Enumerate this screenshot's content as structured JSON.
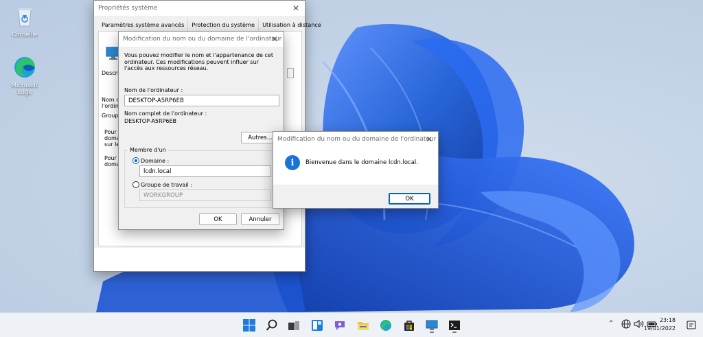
{
  "desktop": {
    "icons": [
      {
        "label": "Corbeille",
        "icon": "recycle-bin-icon"
      },
      {
        "label": "Microsoft Edge",
        "icon": "edge-icon"
      }
    ]
  },
  "system_properties": {
    "title": "Propriétés système",
    "tabs": [
      "Paramètres système avancés",
      "Protection du système",
      "Utilisation à distance"
    ],
    "fragments": {
      "descr": "Descrip",
      "nom1": "Nom co",
      "nom2": "l'ordina",
      "groupe": "Groupe",
      "pour1a": "Pour u",
      "pour1b": "domair",
      "pour1c": "sur le n",
      "pour2a": "Pour re",
      "pour2b": "domain"
    }
  },
  "rename_dialog": {
    "title": "Modification du nom ou du domaine de l'ordinateur",
    "intro": "Vous pouvez modifier le nom et l'appartenance de cet ordinateur. Ces modifications peuvent influer sur l'accès aux ressources réseau.",
    "computer_name_label": "Nom de l'ordinateur :",
    "computer_name_value": "DESKTOP-A5RP6EB",
    "full_name_label": "Nom complet de l'ordinateur :",
    "full_name_value": "DESKTOP-A5RP6EB",
    "more_button": "Autres...",
    "member_of_label": "Membre d'un",
    "domain_label": "Domaine :",
    "domain_value": "lcdn.local",
    "workgroup_label": "Groupe de travail :",
    "workgroup_value": "WORKGROUP",
    "ok_button": "OK",
    "cancel_button": "Annuler"
  },
  "welcome_dialog": {
    "title": "Modification du nom ou du domaine de l'ordinateur",
    "message": "Bienvenue dans le domaine lcdn.local.",
    "ok_button": "OK"
  },
  "taskbar": {
    "apps": [
      "start-icon",
      "search-icon",
      "task-view-icon",
      "widgets-icon",
      "chat-icon",
      "file-explorer-icon",
      "edge-icon",
      "store-icon",
      "system-properties-icon",
      "terminal-icon"
    ],
    "time": "23:18",
    "date": "19/01/2022"
  },
  "colors": {
    "accent": "#0067c0",
    "info": "#1a73d9",
    "bloom": "#1e5fd6"
  }
}
